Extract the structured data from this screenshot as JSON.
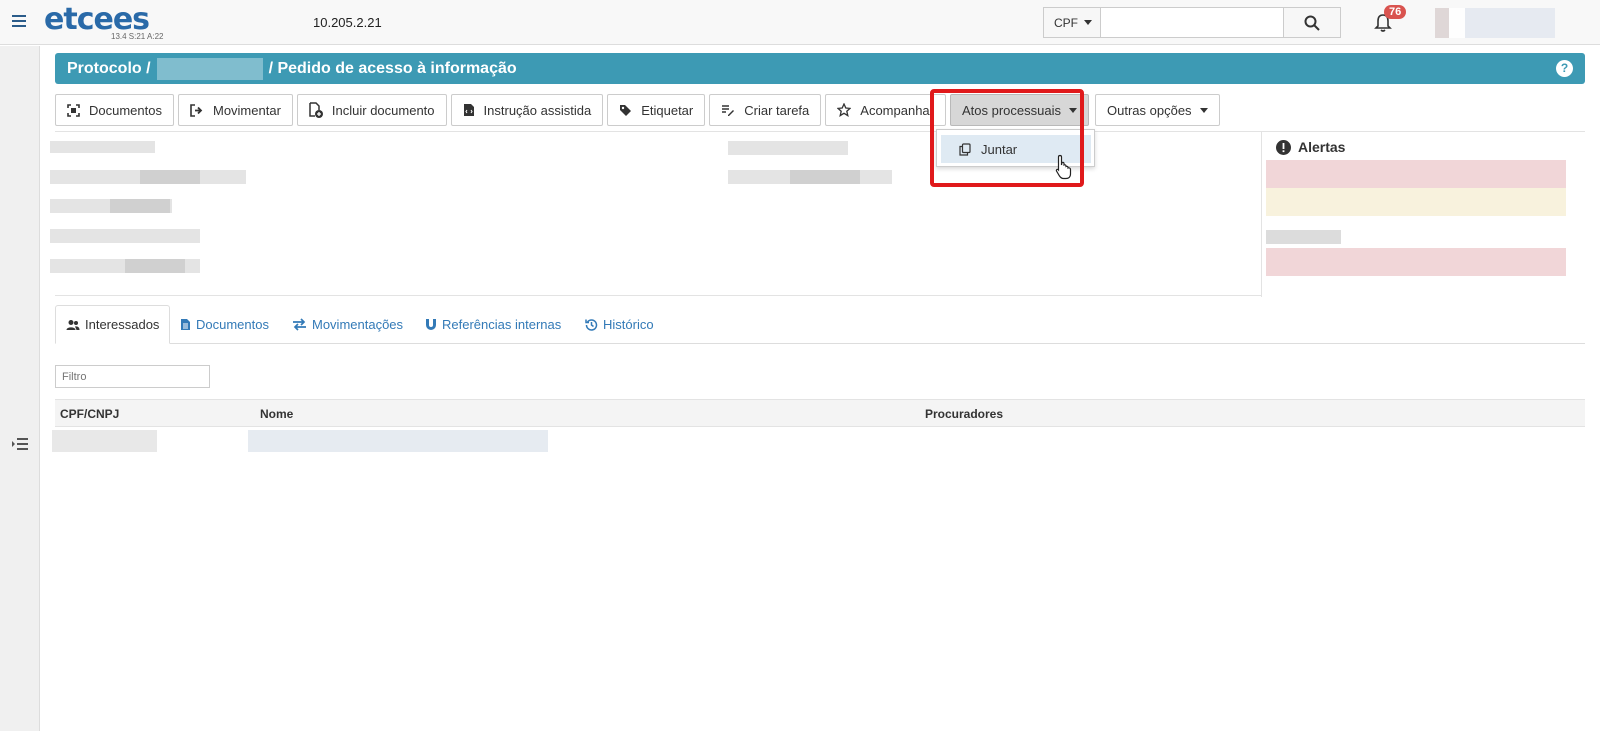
{
  "topbar": {
    "logo_text": "etcees",
    "version": "13.4 S:21 A:22",
    "ip": "10.205.2.21",
    "search": {
      "type_label": "CPF",
      "placeholder": ""
    },
    "notifications_count": "76"
  },
  "title": {
    "prefix": "Protocolo /",
    "suffix": "/ Pedido de acesso à informação"
  },
  "toolbar": {
    "documentos": "Documentos",
    "movimentar": "Movimentar",
    "incluir": "Incluir documento",
    "instrucao": "Instrução assistida",
    "etiquetar": "Etiquetar",
    "criar_tarefa": "Criar tarefa",
    "acompanhar": "Acompanhar",
    "atos": "Atos processuais",
    "outras": "Outras opções"
  },
  "dropdown": {
    "item": "Juntar"
  },
  "alerts": {
    "title": "Alertas"
  },
  "tabs": {
    "interessados": "Interessados",
    "documentos": "Documentos",
    "movimentacoes": "Movimentações",
    "referencias": "Referências internas",
    "historico": "Histórico"
  },
  "filter": {
    "placeholder": "Filtro"
  },
  "table": {
    "col1": "CPF/CNPJ",
    "col2": "Nome",
    "col3": "Procuradores"
  },
  "colors": {
    "accent": "#3d9ab4",
    "badge": "#d9534f",
    "highlight": "#e0191b",
    "link": "#337ab7"
  }
}
